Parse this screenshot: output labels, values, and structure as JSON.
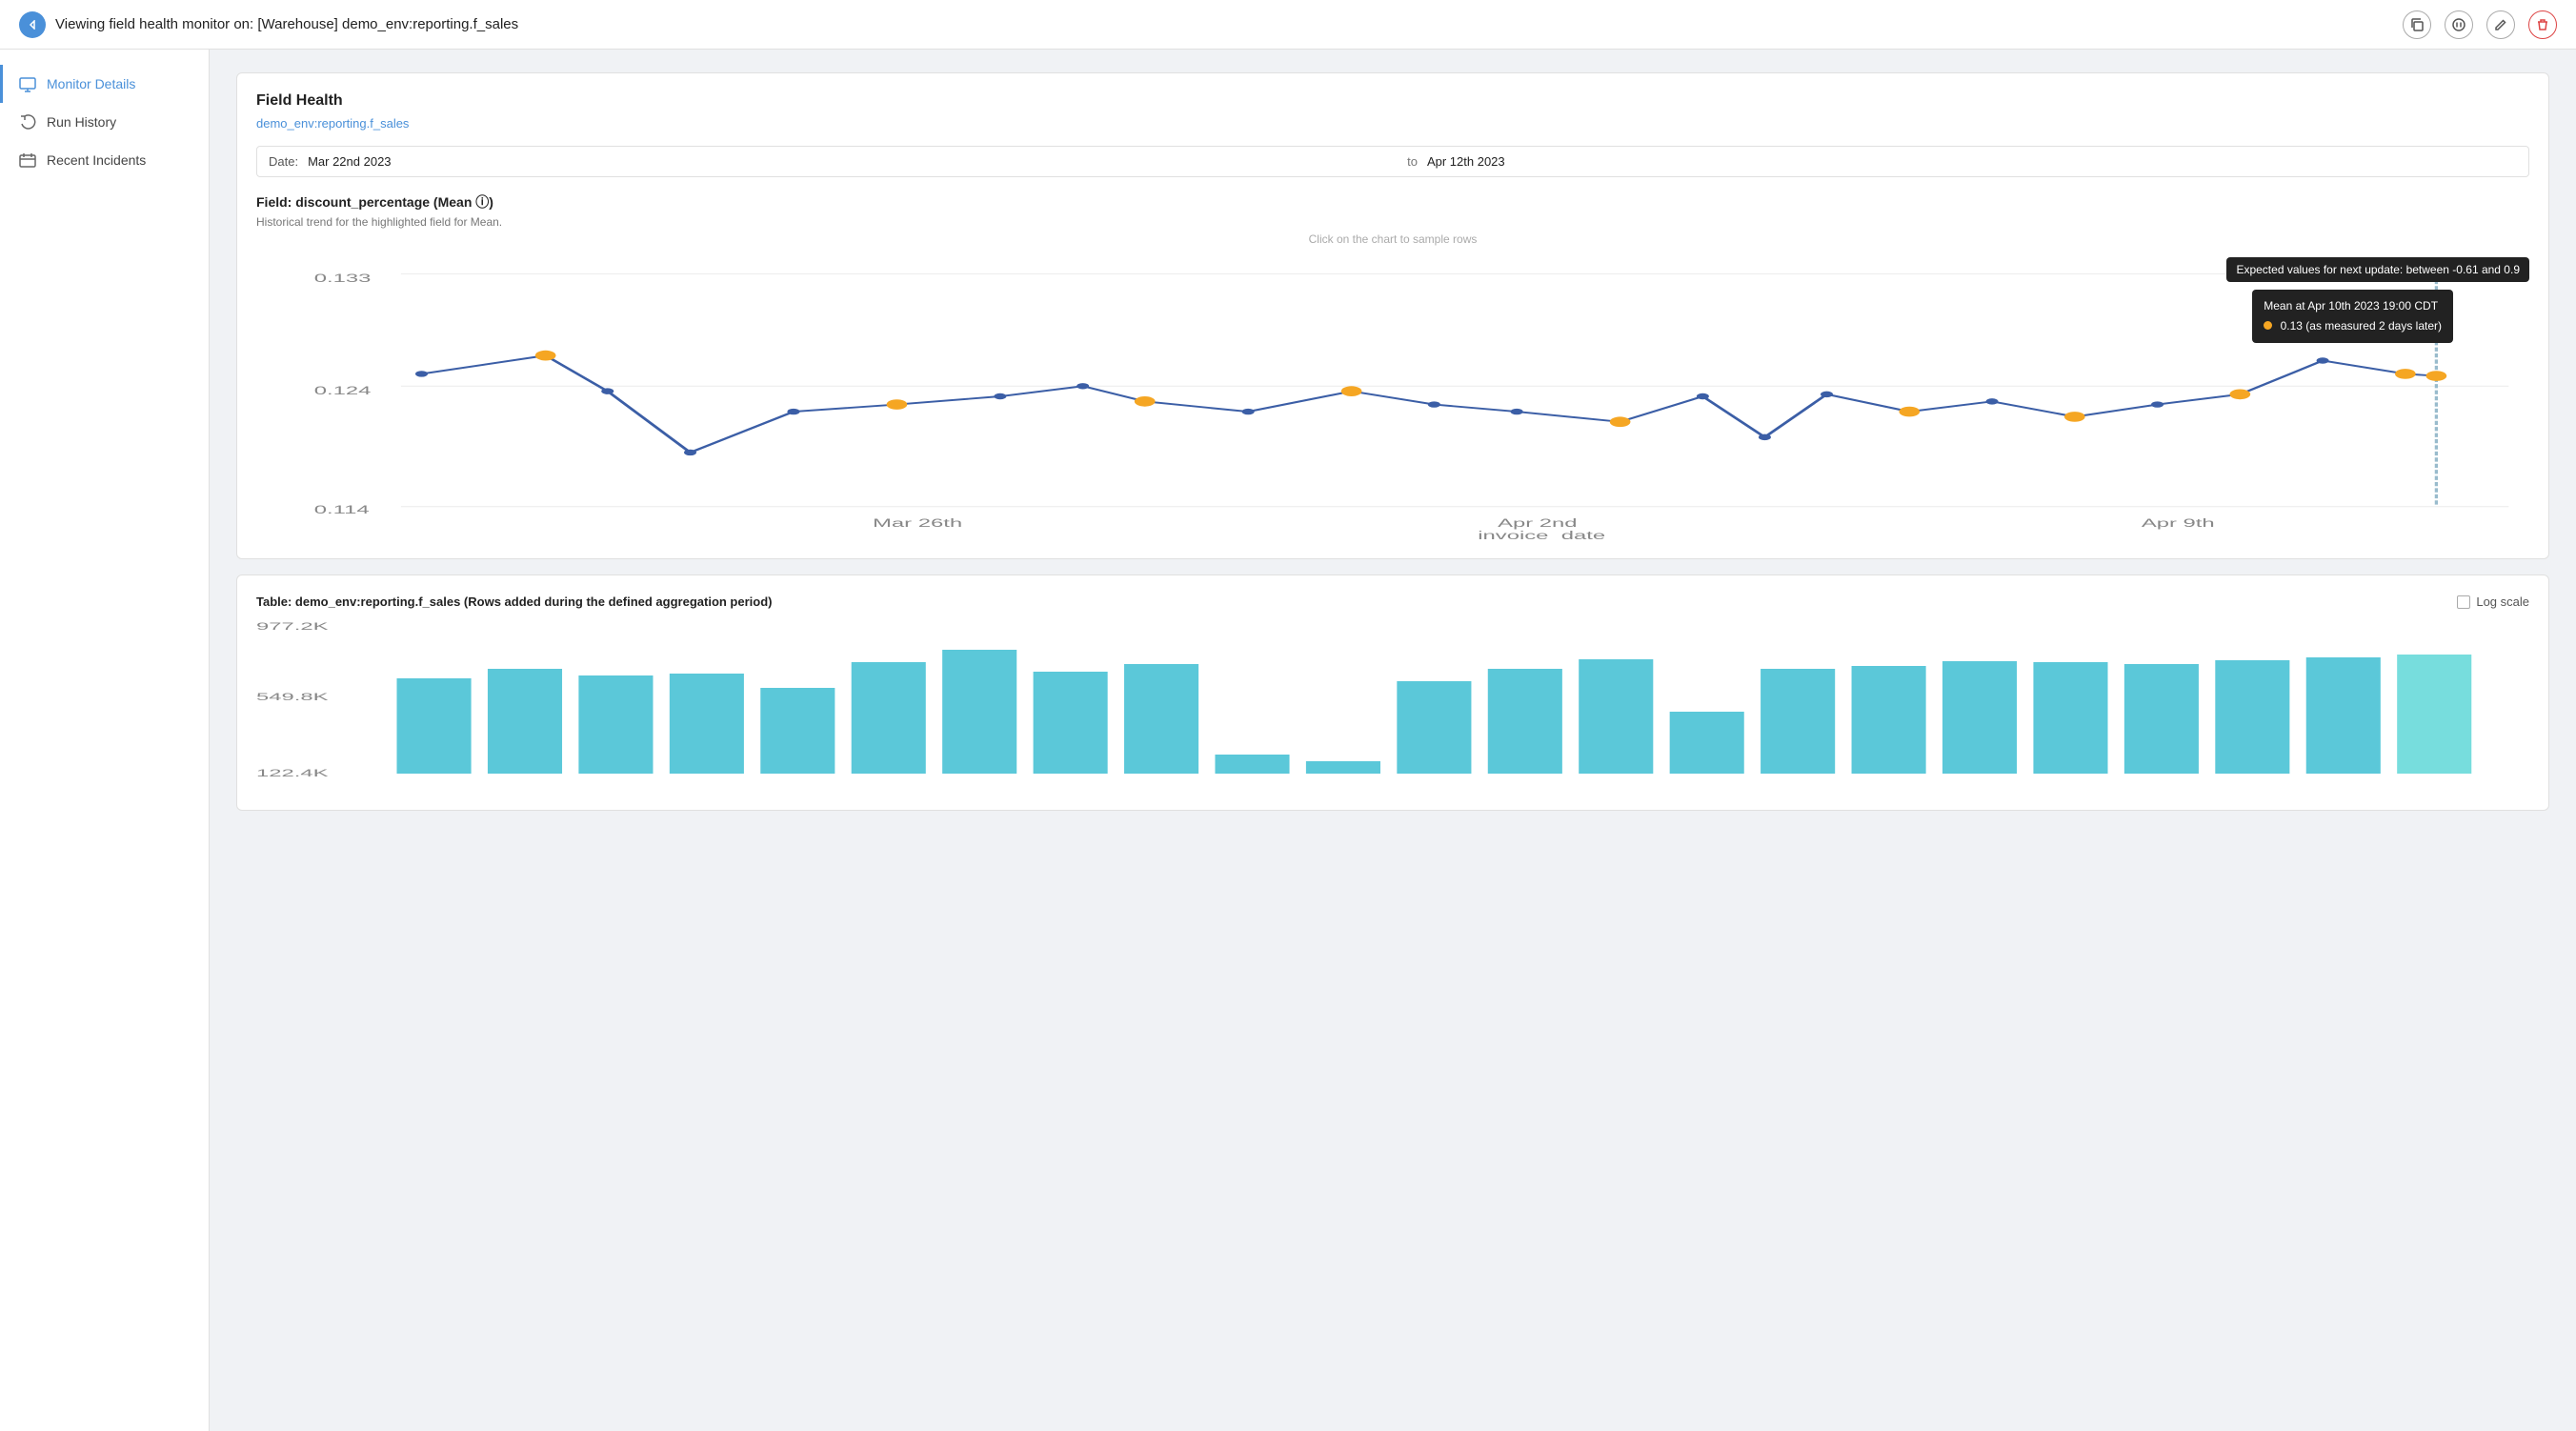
{
  "header": {
    "title": "Viewing field health monitor on: [Warehouse] demo_env:reporting.f_sales",
    "icons": {
      "back": "◀",
      "copy": "copy-icon",
      "pause": "pause-icon",
      "edit": "edit-icon",
      "delete": "delete-icon"
    }
  },
  "sidebar": {
    "items": [
      {
        "id": "monitor-details",
        "label": "Monitor Details",
        "active": true
      },
      {
        "id": "run-history",
        "label": "Run History",
        "active": false
      },
      {
        "id": "recent-incidents",
        "label": "Recent Incidents",
        "active": false
      }
    ]
  },
  "main": {
    "field_health": {
      "title": "Field Health",
      "link": "demo_env:reporting.f_sales"
    },
    "date_range": {
      "label": "Date:",
      "from": "Mar 22nd 2023",
      "to": "Apr 12th 2023",
      "separator": "to"
    },
    "line_chart": {
      "field_title": "Field: discount_percentage (Mean ⓘ)",
      "subtitle": "Historical trend for the highlighted field for Mean.",
      "hint": "Click on the chart to sample rows",
      "y_axis": {
        "max": "0.133",
        "mid": "0.124",
        "min": "0.114"
      },
      "x_axis": [
        "Mar 26th",
        "Apr 2nd\ninvoice_date",
        "Apr 9th"
      ],
      "tooltip": {
        "header": "Mean at Apr 10th 2023 19:00 CDT",
        "value": "0.13 (as measured 2 days later)"
      },
      "expected_tooltip": "Expected values for next update: between -0.61 and 0.9"
    },
    "bar_chart": {
      "title": "Table: demo_env:reporting.f_sales (Rows added during the defined aggregation period)",
      "log_scale_label": "Log scale",
      "y_axis": {
        "max": "977.2K",
        "mid": "549.8K",
        "min": "122.4K"
      }
    }
  }
}
